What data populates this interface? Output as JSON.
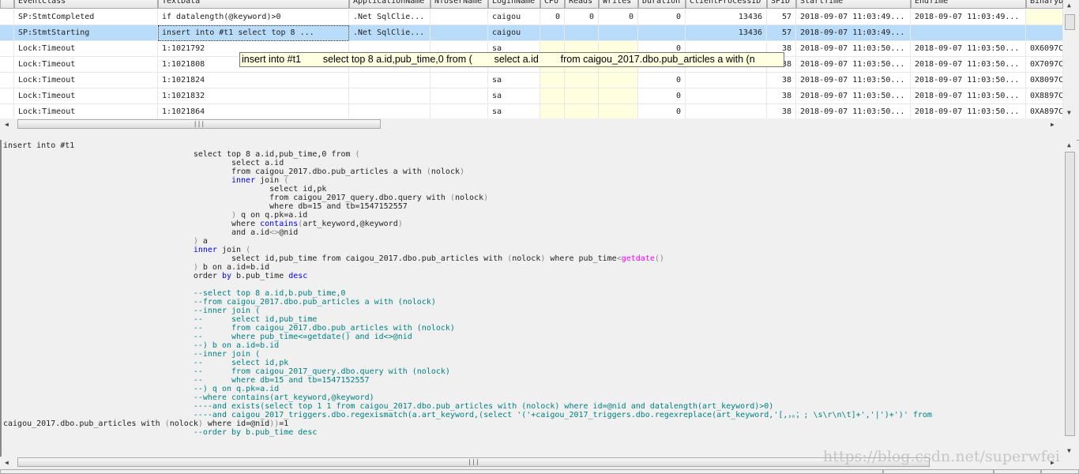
{
  "grid": {
    "columns": [
      "EventClass",
      "TextData",
      "ApplicationName",
      "NTUserName",
      "LoginName",
      "CPU",
      "Reads",
      "Writes",
      "Duration",
      "ClientProcessID",
      "SPID",
      "StartTime",
      "EndTime",
      "BinaryD"
    ],
    "rows": [
      [
        "SP:StmtCompleted",
        "if datalength(@keyword)>0",
        ".Net SqlClie...",
        "",
        "caigou",
        "0",
        "0",
        "0",
        "0",
        "13436",
        "57",
        "2018-09-07 11:03:49...",
        "2018-09-07 11:03:49...",
        ""
      ],
      [
        "SP:StmtStarting",
        "insert into #t1        select top 8 ...",
        ".Net SqlClie...",
        "",
        "caigou",
        "",
        "",
        "",
        "",
        "13436",
        "57",
        "2018-09-07 11:03:49...",
        "",
        ""
      ],
      [
        "Lock:Timeout",
        "1:1021792",
        "",
        "",
        "sa",
        "",
        "",
        "",
        "0",
        "",
        "38",
        "2018-09-07 11:03:50...",
        "2018-09-07 11:03:50...",
        "0X6097C"
      ],
      [
        "Lock:Timeout",
        "1:1021808",
        "",
        "",
        "sa",
        "",
        "",
        "",
        "0",
        "",
        "38",
        "2018-09-07 11:03:50...",
        "2018-09-07 11:03:50...",
        "0X7097C"
      ],
      [
        "Lock:Timeout",
        "1:1021824",
        "",
        "",
        "sa",
        "",
        "",
        "",
        "0",
        "",
        "38",
        "2018-09-07 11:03:50...",
        "2018-09-07 11:03:50...",
        "0X8097C"
      ],
      [
        "Lock:Timeout",
        "1:1021832",
        "",
        "",
        "sa",
        "",
        "",
        "",
        "0",
        "",
        "38",
        "2018-09-07 11:03:50...",
        "2018-09-07 11:03:50...",
        "0X8897C"
      ],
      [
        "Lock:Timeout",
        "1:1021864",
        "",
        "",
        "sa",
        "",
        "",
        "",
        "0",
        "",
        "38",
        "2018-09-07 11:03:50...",
        "2018-09-07 11:03:50...",
        "0XA897C"
      ]
    ],
    "selected_row": 1
  },
  "tooltip": "insert into #t1        select top 8 a.id,pub_time,0 from (        select a.id        from caigou_2017.dbo.pub_articles a with (n",
  "sql_text": [
    "insert into #t1",
    "\t\t\t\t\tselect top 8 a.id,pub_time,0 from (",
    "\t\t\t\t\t\tselect a.id",
    "\t\t\t\t\t\tfrom caigou_2017.dbo.pub_articles a with (nolock)",
    "\t\t\t\t\t\tinner join (",
    "\t\t\t\t\t\t\tselect id,pk",
    "\t\t\t\t\t\t\tfrom caigou_2017_query.dbo.query with (nolock)",
    "\t\t\t\t\t\t\twhere db=15 and tb=1547152557",
    "\t\t\t\t\t\t) q on q.pk=a.id",
    "\t\t\t\t\t\twhere contains(art_keyword,@keyword)",
    "\t\t\t\t\t\tand a.id<>@nid",
    "\t\t\t\t\t) a",
    "\t\t\t\t\tinner join (",
    "\t\t\t\t\t\tselect id,pub_time from caigou_2017.dbo.pub_articles with (nolock) where pub_time<getdate()",
    "\t\t\t\t\t) b on a.id=b.id",
    "\t\t\t\t\torder by b.pub_time desc",
    "",
    "\t\t\t\t\t--select top 8 a.id,b.pub_time,0",
    "\t\t\t\t\t--from caigou_2017.dbo.pub_articles a with (nolock)",
    "\t\t\t\t\t--inner join (",
    "\t\t\t\t\t--\tselect id,pub_time",
    "\t\t\t\t\t--\tfrom caigou_2017.dbo.pub_articles with (nolock)",
    "\t\t\t\t\t--\twhere pub_time<=getdate() and id<>@nid",
    "\t\t\t\t\t--) b on a.id=b.id",
    "\t\t\t\t\t--inner join (",
    "\t\t\t\t\t--\tselect id,pk",
    "\t\t\t\t\t--\tfrom caigou_2017_query.dbo.query with (nolock)",
    "\t\t\t\t\t--\twhere db=15 and tb=1547152557",
    "\t\t\t\t\t--) q on q.pk=a.id",
    "\t\t\t\t\t--where contains(art_keyword,@keyword)",
    "\t\t\t\t\t----and exists(select top 1 1 from caigou_2017.dbo.pub_articles with (nolock) where id=@nid and datalength(art_keyword)>0)",
    "\t\t\t\t\t----and caigou_2017_triggers.dbo.regexismatch(a.art_keyword,(select '('+caigou_2017_triggers.dbo.regexreplace(art_keyword,'[,，。；; \\s\\r\\n\\t]+','|')+')' from",
    "caigou_2017.dbo.pub_articles with (nolock) where id=@nid))=1",
    "\t\t\t\t\t--order by b.pub_time desc"
  ],
  "watermark": "https://blog.csdn.net/superwfei",
  "colors": {
    "selection": "#b9dcfb",
    "keyword": "#0000ff",
    "comment": "#008080",
    "function": "#ff00ff",
    "tooltip_bg": "#ffffe1"
  }
}
